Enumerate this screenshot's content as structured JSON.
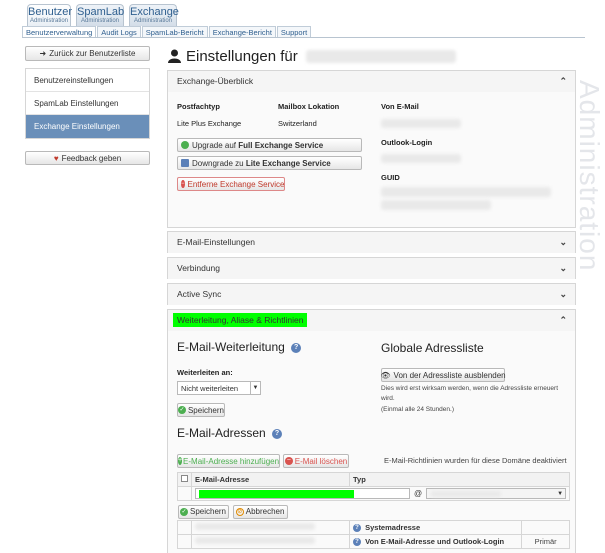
{
  "top_tabs": [
    {
      "label": "Benutzer",
      "sublabel": "Administration",
      "active": true
    },
    {
      "label": "SpamLab",
      "sublabel": "Administration",
      "active": false
    },
    {
      "label": "Exchange",
      "sublabel": "Administration",
      "active": false
    }
  ],
  "sub_nav": [
    "Benutzerverwaltung",
    "Audit Logs",
    "SpamLab-Bericht",
    "Exchange-Bericht",
    "Support"
  ],
  "sidebar": {
    "back_label": "Zurück zur Benutzerliste",
    "items": [
      "Benutzereinstellungen",
      "SpamLab Einstellungen",
      "Exchange Einstellungen"
    ],
    "feedback_label": "Feedback geben"
  },
  "page_title": "Einstellungen für",
  "watermark": "Administration",
  "exchange_overview": {
    "title": "Exchange-Überblick",
    "col_mailbox_type": "Postfachtyp",
    "col_location": "Mailbox Lokation",
    "mailbox_type_value": "Lite Plus Exchange",
    "location_value": "Switzerland",
    "from_email_label": "Von E-Mail",
    "outlook_login_label": "Outlook-Login",
    "guid_label": "GUID",
    "upgrade_prefix": "Upgrade auf ",
    "upgrade_bold": "Full Exchange Service",
    "downgrade_prefix": "Downgrade zu ",
    "downgrade_bold": "Lite Exchange Service",
    "remove_label": "Entferne Exchange Service"
  },
  "collapsed_sections": [
    "E-Mail-Einstellungen",
    "Verbindung",
    "Active Sync"
  ],
  "forwarding_section": {
    "title": "Weiterleitung, Aliase & Richtlinien",
    "forwarding_heading": "E-Mail-Weiterleitung",
    "forward_to_label": "Weiterleiten an:",
    "forward_select_value": "Nicht weiterleiten",
    "save_label": "Speichern",
    "gal_heading": "Globale Adressliste",
    "gal_hide_button": "Von der Adressliste ausblenden",
    "gal_note_line1": "Dies wird erst wirksam werden, wenn die Adressliste erneuert",
    "gal_note_line2": "wird.",
    "gal_note_line3": "(Einmal alle 24 Stunden.)",
    "addresses_heading": "E-Mail-Adressen",
    "add_address_button": "E-Mail-Adresse hinzufügen",
    "delete_address_button": "E-Mail löschen",
    "policy_note": "E-Mail-Richtlinien wurden für diese Domäne deaktiviert",
    "col_address": "E-Mail-Adresse",
    "col_type": "Typ",
    "at_sign": "@",
    "cancel_label": "Abbrechen",
    "row_system": "Systemadresse",
    "row_primary_type": "Von E-Mail-Adresse und Outlook-Login",
    "row_primary_flag": "Primär"
  },
  "colors": {
    "highlight": "#00ff00",
    "accent": "#6a8fb9",
    "link": "#2f5f8f"
  }
}
